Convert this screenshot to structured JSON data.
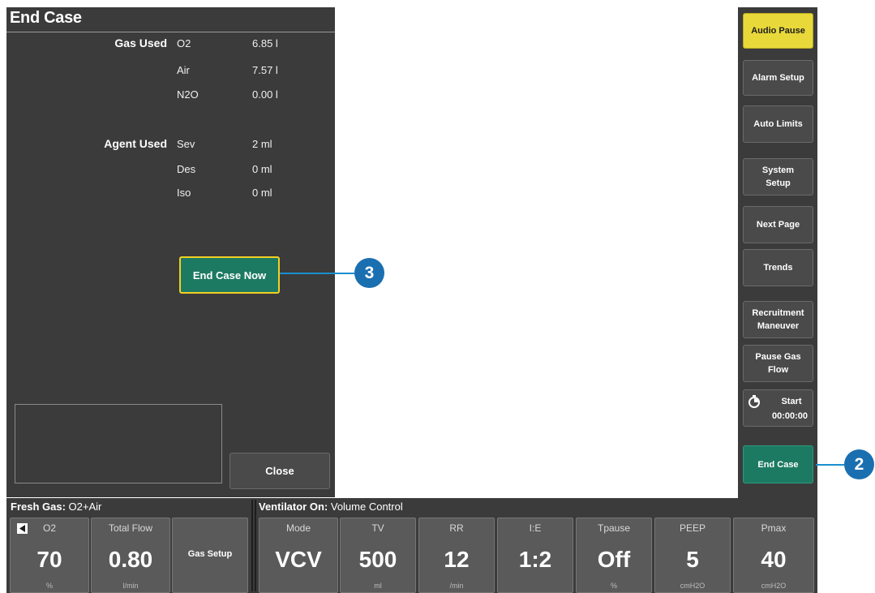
{
  "panel": {
    "title": "End Case",
    "gas_used_label": "Gas Used",
    "gas_used": [
      {
        "name": "O2",
        "value": "6.85 l"
      },
      {
        "name": "Air",
        "value": "7.57 l"
      },
      {
        "name": "N2O",
        "value": "0.00 l"
      }
    ],
    "agent_used_label": "Agent Used",
    "agent_used": [
      {
        "name": "Sev",
        "value": "2 ml"
      },
      {
        "name": "Des",
        "value": "0 ml"
      },
      {
        "name": "Iso",
        "value": "0 ml"
      }
    ],
    "end_case_now_label": "End Case Now",
    "close_label": "Close"
  },
  "right_column": {
    "audio_pause": "Audio Pause",
    "alarm_setup": "Alarm Setup",
    "auto_limits": "Auto Limits",
    "system_setup": "System\nSetup",
    "next_page": "Next Page",
    "trends": "Trends",
    "recruitment": "Recruitment\nManeuver",
    "pause_gas_flow": "Pause Gas\nFlow",
    "timer_start": "Start",
    "timer_time": "00:00:00",
    "end_case": "End Case"
  },
  "callouts": {
    "three": "3",
    "two": "2"
  },
  "bottom": {
    "fresh_gas_label": "Fresh Gas:",
    "fresh_gas_value": "O2+Air",
    "ventilator_label": "Ventilator On:",
    "ventilator_value": "Volume Control",
    "o2": {
      "name": "O2",
      "value": "70",
      "unit": "%"
    },
    "total_flow": {
      "name": "Total Flow",
      "value": "0.80",
      "unit": "l/min"
    },
    "gas_setup": "Gas Setup",
    "mode": {
      "name": "Mode",
      "value": "VCV"
    },
    "tv": {
      "name": "TV",
      "value": "500",
      "unit": "ml"
    },
    "rr": {
      "name": "RR",
      "value": "12",
      "unit": "/min"
    },
    "ie": {
      "name": "I:E",
      "value": "1:2"
    },
    "tpause": {
      "name": "Tpause",
      "value": "Off",
      "unit": "%"
    },
    "peep": {
      "name": "PEEP",
      "value": "5",
      "unit": "cmH2O"
    },
    "pmax": {
      "name": "Pmax",
      "value": "40",
      "unit": "cmH2O"
    }
  },
  "colors": {
    "panel_bg": "#3b3b3b",
    "accent_green": "#1d7a62",
    "audio_pause_yellow": "#e8d83a",
    "callout_blue": "#1a6fb0",
    "highlight_border": "#f0d023"
  }
}
